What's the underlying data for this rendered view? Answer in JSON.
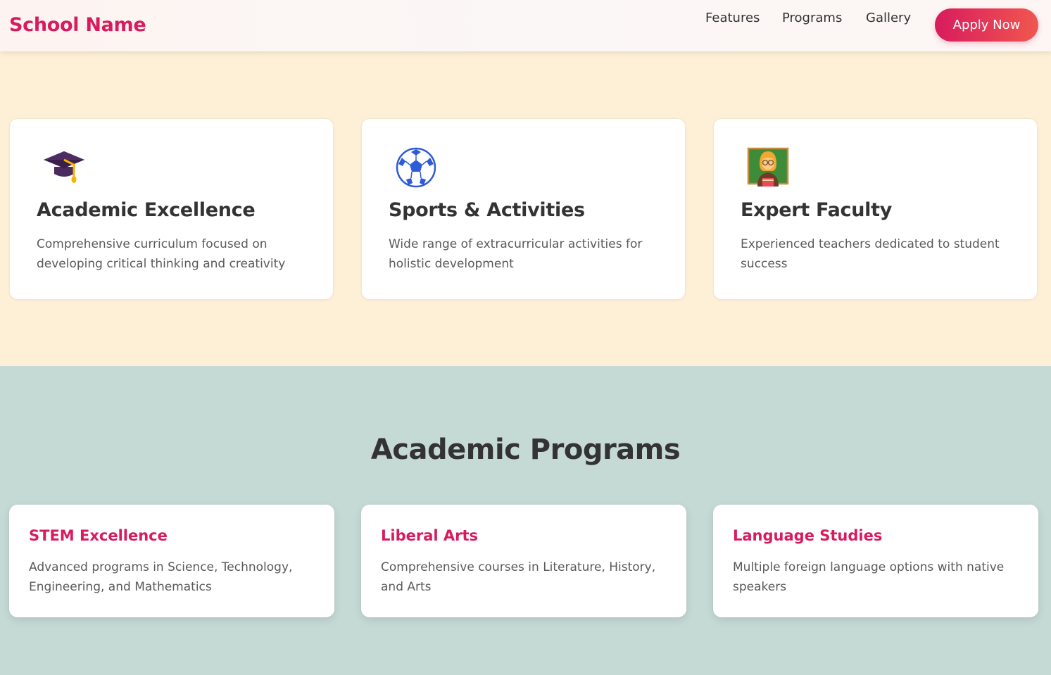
{
  "header": {
    "brand": "School Name",
    "nav": [
      "Features",
      "Programs",
      "Gallery"
    ],
    "cta": "Apply Now"
  },
  "features": [
    {
      "icon": "graduation-cap-icon",
      "title": "Academic Excellence",
      "description": "Comprehensive curriculum focused on developing critical thinking and creativity"
    },
    {
      "icon": "soccer-ball-icon",
      "title": "Sports & Activities",
      "description": "Wide range of extracurricular activities for holistic development"
    },
    {
      "icon": "teacher-icon",
      "title": "Expert Faculty",
      "description": "Experienced teachers dedicated to student success"
    }
  ],
  "programs": {
    "title": "Academic Programs",
    "items": [
      {
        "title": "STEM Excellence",
        "description": "Advanced programs in Science, Technology, Engineering, and Mathematics"
      },
      {
        "title": "Liberal Arts",
        "description": "Comprehensive courses in Literature, History, and Arts"
      },
      {
        "title": "Language Studies",
        "description": "Multiple foreign language options with native speakers"
      }
    ]
  },
  "colors": {
    "accent": "#d81b5e",
    "features_bg": "#fef0d6",
    "programs_bg": "#c5d9d5"
  }
}
